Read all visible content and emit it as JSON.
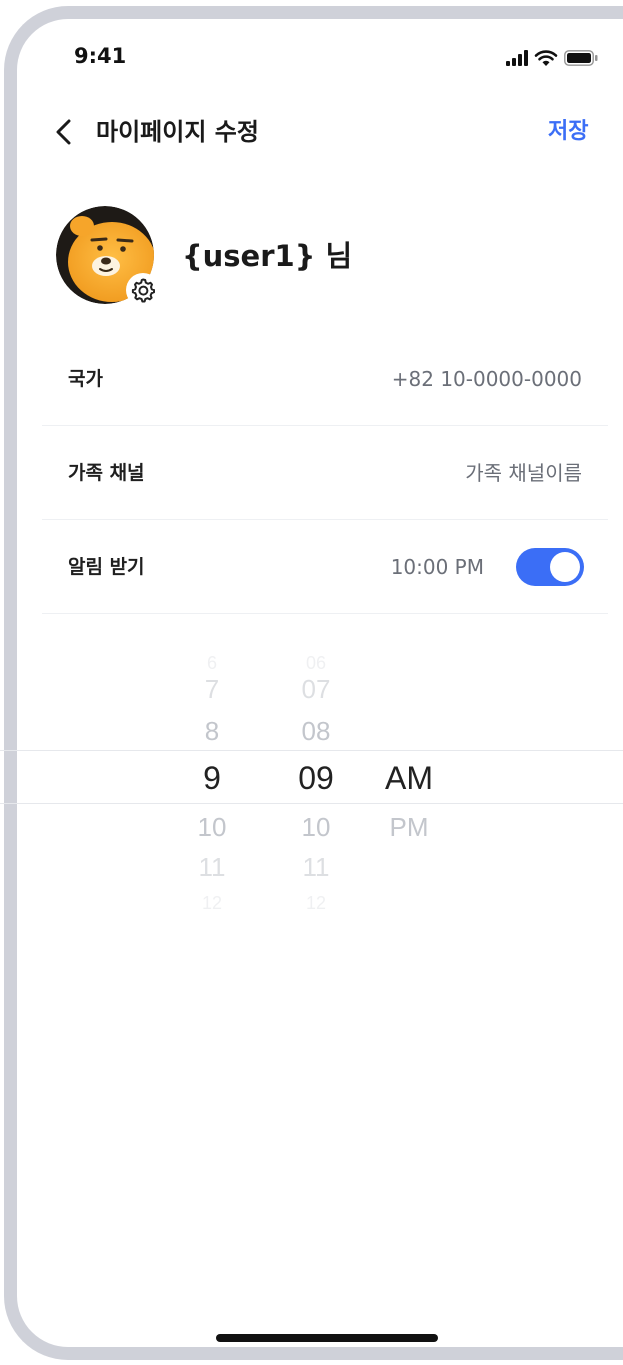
{
  "status_bar": {
    "time": "9:41"
  },
  "header": {
    "back_icon": "chevron-left-icon",
    "title": "마이페이지 수정",
    "save_label": "저장"
  },
  "profile": {
    "user_name": "{user1} 님",
    "edit_icon": "gear-icon"
  },
  "settings": {
    "country": {
      "label": "국가",
      "value": "+82 10-0000-0000"
    },
    "family_channel": {
      "label": "가족 채널",
      "value": "가족 채널이름"
    },
    "notifications": {
      "label": "알림 받기",
      "value": "10:00 PM",
      "enabled": true
    }
  },
  "time_picker": {
    "hours": [
      "6",
      "7",
      "8",
      "9",
      "10",
      "11",
      "12"
    ],
    "minutes": [
      "06",
      "07",
      "08",
      "09",
      "10",
      "11",
      "12"
    ],
    "periods": [
      "AM",
      "PM"
    ],
    "selected_hour": "9",
    "selected_minute": "09",
    "selected_period": "AM"
  },
  "colors": {
    "accent": "#3b6ef6",
    "text_primary": "#1a1a1a",
    "text_secondary": "#6b6f78",
    "frame": "#cfd1d9"
  }
}
